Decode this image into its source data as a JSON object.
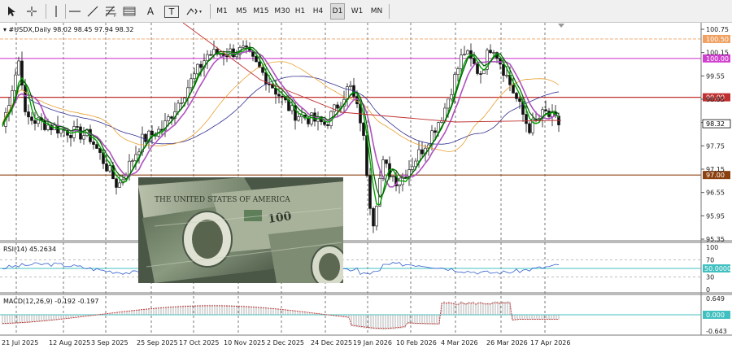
{
  "toolbar": {
    "timeframes": [
      "M1",
      "M5",
      "M15",
      "M30",
      "H1",
      "H4",
      "D1",
      "W1",
      "MN"
    ],
    "active_timeframe": "D1",
    "text_tool": "A",
    "label_tool": "T"
  },
  "main_pane": {
    "symbol_label": "▾ #USDX,Daily  98.02 98.45 97.94 98.32",
    "price_ticks": [
      "100.75",
      "100.15",
      "99.55",
      "98.95",
      "98.35",
      "97.75",
      "97.15",
      "96.55",
      "95.95",
      "95.35"
    ],
    "hlines": [
      {
        "label": "100.50",
        "color": "#f0a060",
        "style": "dash"
      },
      {
        "label": "100.00",
        "color": "#d040d0",
        "style": "solid"
      },
      {
        "label": "99.00",
        "color": "#c03030",
        "style": "solid"
      },
      {
        "label": "97.00",
        "color": "#8b4010",
        "style": "solid"
      }
    ],
    "current_price": "98.32"
  },
  "rsi_pane": {
    "label": "RSI(14) 45.2634",
    "ticks": [
      "100",
      "70",
      "50",
      "30",
      "0"
    ],
    "level_label": "50.0000",
    "level_color": "#40c0c0"
  },
  "macd_pane": {
    "label": "MACD(12,26,9) -0.192 -0.197",
    "ticks": [
      "0.649",
      "0.000",
      "-0.643"
    ],
    "zero_label": "0.000"
  },
  "dates": [
    "21 Jul 2025",
    "12 Aug 2025",
    "3 Sep 2025",
    "25 Sep 2025",
    "17 Oct 2025",
    "10 Nov 2025",
    "2 Dec 2025",
    "24 Dec 2025",
    "19 Jan 2026",
    "10 Feb 2026",
    "4 Mar 2026",
    "26 Mar 2026",
    "17 Apr 2026"
  ],
  "colors": {
    "ma_fast": "#00a000",
    "ma_mid": "#006000",
    "ma_violet": "#b050c0",
    "ma_orange": "#e8a030",
    "ma_blue": "#303090",
    "ma_red": "#c03030",
    "rsi": "#3060d0",
    "macd_signal": "#c03030",
    "macd_hist": "#a0a0a0"
  }
}
